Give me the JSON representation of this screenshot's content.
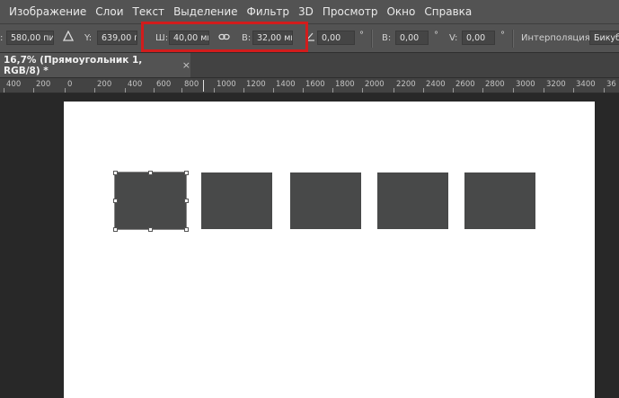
{
  "menu": [
    "Изображение",
    "Слои",
    "Текст",
    "Выделение",
    "Фильтр",
    "3D",
    "Просмотр",
    "Окно",
    "Справка"
  ],
  "options": {
    "x_value": "580,00 пи",
    "y_label": "Y:",
    "y_value": "639,00 пи",
    "w_label": "Ш:",
    "w_value": "40,00 мм",
    "h_label": "В:",
    "h_value": "32,00 мм",
    "angle_value": "0,00",
    "hskew_label": "В:",
    "hskew_value": "0,00",
    "vskew_label": "V:",
    "vskew_value": "0,00",
    "degree": "°",
    "interp_label": "Интерполяция:",
    "interp_value": "Бикуб"
  },
  "tab": {
    "title": "16,7% (Прямоугольник 1, RGB/8) *",
    "close": "×"
  },
  "ruler_labels": [
    "400",
    "200",
    "0",
    "200",
    "400",
    "600",
    "800",
    "1000",
    "1200",
    "1400",
    "1600",
    "1800",
    "2000",
    "2200",
    "2400",
    "2600",
    "2800",
    "3000",
    "3200",
    "3400",
    "36"
  ],
  "shapes_count": 5,
  "colors": {
    "highlight": "#d21c1c",
    "shape": "#484949",
    "chrome": "#535353"
  }
}
